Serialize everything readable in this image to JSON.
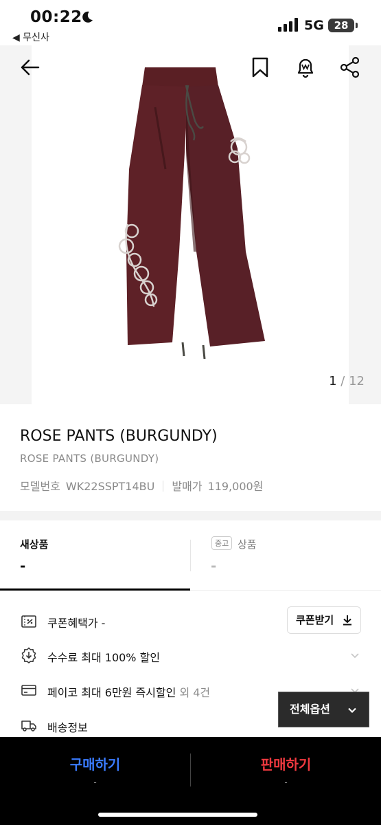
{
  "status_bar": {
    "time": "00:22",
    "back_app": "◀ 무신사",
    "network": "5G",
    "battery": "28"
  },
  "product_image": {
    "page_current": "1",
    "page_total": "/ 12",
    "colors": {
      "pants": "#5a1f24",
      "embroidery": "#d8d2cf"
    }
  },
  "product": {
    "title": "ROSE PANTS (BURGUNDY)",
    "subtitle": "ROSE PANTS (BURGUNDY)",
    "model_label": "모델번호",
    "model_number": "WK22SSPT14BU",
    "release_label": "발매가",
    "release_price": "119,000원"
  },
  "tabs": {
    "new_label": "새상품",
    "new_price": "-",
    "used_badge": "중고",
    "used_label": "상품",
    "used_price": "-"
  },
  "benefits": {
    "coupon_text": "쿠폰혜택가 -",
    "coupon_button": "쿠폰받기",
    "fee_text": "수수료 최대 100% 할인",
    "payco_text": "페이코 최대 6만원 즉시할인",
    "payco_extra": " 외 4건",
    "delivery_text": "배송정보"
  },
  "floating": {
    "options_button": "전체옵션"
  },
  "bottom_bar": {
    "buy_label": "구매하기",
    "buy_price": "-",
    "sell_label": "판매하기",
    "sell_price": "-",
    "colors": {
      "buy": "#3a7bff",
      "sell": "#f0393f"
    }
  }
}
